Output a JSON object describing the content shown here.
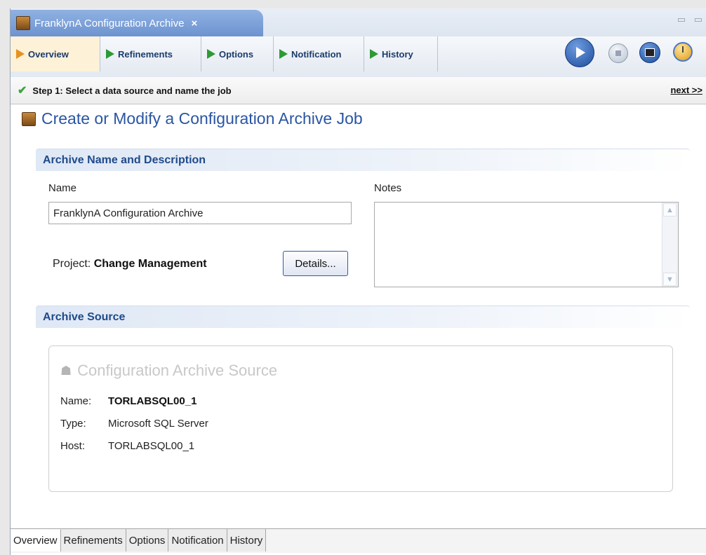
{
  "editor_tab": {
    "title": "FranklynA Configuration Archive",
    "close": "×"
  },
  "window_controls": "▭ ▭",
  "step_tabs": [
    {
      "label": "Overview",
      "active": true
    },
    {
      "label": "Refinements",
      "active": false
    },
    {
      "label": "Options",
      "active": false
    },
    {
      "label": "Notification",
      "active": false
    },
    {
      "label": "History",
      "active": false
    }
  ],
  "toolbar_icons": [
    "play-icon",
    "stop-icon",
    "console-icon",
    "clock-icon"
  ],
  "step": {
    "check": "✔",
    "text": "Step 1: Select a data source and name the job",
    "next": "next >>"
  },
  "page_title": "Create or Modify a Configuration Archive Job",
  "archive": {
    "section_title": "Archive Name and Description",
    "name_label": "Name",
    "name_value": "FranklynA Configuration Archive",
    "notes_label": "Notes",
    "notes_value": "",
    "project_label": "Project: ",
    "project_value": "Change Management",
    "details_button": "Details..."
  },
  "source": {
    "section_title": "Archive Source",
    "box_title": "Configuration Archive Source",
    "name_label": "Name:",
    "name_value": "TORLABSQL00_1",
    "type_label": "Type:",
    "type_value": "Microsoft SQL Server",
    "host_label": "Host:",
    "host_value": "TORLABSQL00_1"
  },
  "bottom_tabs": [
    "Overview",
    "Refinements",
    "Options",
    "Notification",
    "History"
  ],
  "colors": {
    "accent_blue": "#2a55a3",
    "section_text": "#1f4a8a",
    "step_green": "#2e9a35",
    "active_orange": "#e6921e"
  }
}
